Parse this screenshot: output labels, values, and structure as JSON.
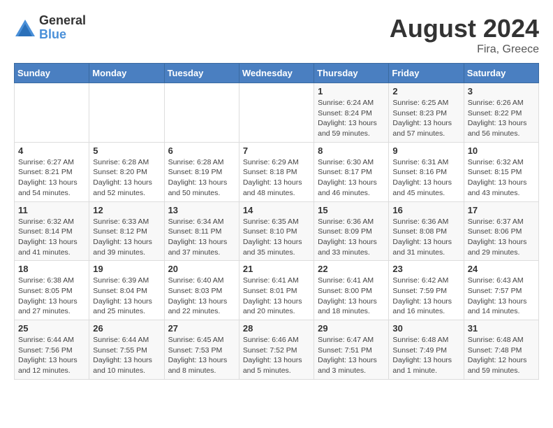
{
  "header": {
    "logo_general": "General",
    "logo_blue": "Blue",
    "month_year": "August 2024",
    "location": "Fira, Greece"
  },
  "weekdays": [
    "Sunday",
    "Monday",
    "Tuesday",
    "Wednesday",
    "Thursday",
    "Friday",
    "Saturday"
  ],
  "weeks": [
    [
      {
        "day": "",
        "detail": ""
      },
      {
        "day": "",
        "detail": ""
      },
      {
        "day": "",
        "detail": ""
      },
      {
        "day": "",
        "detail": ""
      },
      {
        "day": "1",
        "detail": "Sunrise: 6:24 AM\nSunset: 8:24 PM\nDaylight: 13 hours\nand 59 minutes."
      },
      {
        "day": "2",
        "detail": "Sunrise: 6:25 AM\nSunset: 8:23 PM\nDaylight: 13 hours\nand 57 minutes."
      },
      {
        "day": "3",
        "detail": "Sunrise: 6:26 AM\nSunset: 8:22 PM\nDaylight: 13 hours\nand 56 minutes."
      }
    ],
    [
      {
        "day": "4",
        "detail": "Sunrise: 6:27 AM\nSunset: 8:21 PM\nDaylight: 13 hours\nand 54 minutes."
      },
      {
        "day": "5",
        "detail": "Sunrise: 6:28 AM\nSunset: 8:20 PM\nDaylight: 13 hours\nand 52 minutes."
      },
      {
        "day": "6",
        "detail": "Sunrise: 6:28 AM\nSunset: 8:19 PM\nDaylight: 13 hours\nand 50 minutes."
      },
      {
        "day": "7",
        "detail": "Sunrise: 6:29 AM\nSunset: 8:18 PM\nDaylight: 13 hours\nand 48 minutes."
      },
      {
        "day": "8",
        "detail": "Sunrise: 6:30 AM\nSunset: 8:17 PM\nDaylight: 13 hours\nand 46 minutes."
      },
      {
        "day": "9",
        "detail": "Sunrise: 6:31 AM\nSunset: 8:16 PM\nDaylight: 13 hours\nand 45 minutes."
      },
      {
        "day": "10",
        "detail": "Sunrise: 6:32 AM\nSunset: 8:15 PM\nDaylight: 13 hours\nand 43 minutes."
      }
    ],
    [
      {
        "day": "11",
        "detail": "Sunrise: 6:32 AM\nSunset: 8:14 PM\nDaylight: 13 hours\nand 41 minutes."
      },
      {
        "day": "12",
        "detail": "Sunrise: 6:33 AM\nSunset: 8:12 PM\nDaylight: 13 hours\nand 39 minutes."
      },
      {
        "day": "13",
        "detail": "Sunrise: 6:34 AM\nSunset: 8:11 PM\nDaylight: 13 hours\nand 37 minutes."
      },
      {
        "day": "14",
        "detail": "Sunrise: 6:35 AM\nSunset: 8:10 PM\nDaylight: 13 hours\nand 35 minutes."
      },
      {
        "day": "15",
        "detail": "Sunrise: 6:36 AM\nSunset: 8:09 PM\nDaylight: 13 hours\nand 33 minutes."
      },
      {
        "day": "16",
        "detail": "Sunrise: 6:36 AM\nSunset: 8:08 PM\nDaylight: 13 hours\nand 31 minutes."
      },
      {
        "day": "17",
        "detail": "Sunrise: 6:37 AM\nSunset: 8:06 PM\nDaylight: 13 hours\nand 29 minutes."
      }
    ],
    [
      {
        "day": "18",
        "detail": "Sunrise: 6:38 AM\nSunset: 8:05 PM\nDaylight: 13 hours\nand 27 minutes."
      },
      {
        "day": "19",
        "detail": "Sunrise: 6:39 AM\nSunset: 8:04 PM\nDaylight: 13 hours\nand 25 minutes."
      },
      {
        "day": "20",
        "detail": "Sunrise: 6:40 AM\nSunset: 8:03 PM\nDaylight: 13 hours\nand 22 minutes."
      },
      {
        "day": "21",
        "detail": "Sunrise: 6:41 AM\nSunset: 8:01 PM\nDaylight: 13 hours\nand 20 minutes."
      },
      {
        "day": "22",
        "detail": "Sunrise: 6:41 AM\nSunset: 8:00 PM\nDaylight: 13 hours\nand 18 minutes."
      },
      {
        "day": "23",
        "detail": "Sunrise: 6:42 AM\nSunset: 7:59 PM\nDaylight: 13 hours\nand 16 minutes."
      },
      {
        "day": "24",
        "detail": "Sunrise: 6:43 AM\nSunset: 7:57 PM\nDaylight: 13 hours\nand 14 minutes."
      }
    ],
    [
      {
        "day": "25",
        "detail": "Sunrise: 6:44 AM\nSunset: 7:56 PM\nDaylight: 13 hours\nand 12 minutes."
      },
      {
        "day": "26",
        "detail": "Sunrise: 6:44 AM\nSunset: 7:55 PM\nDaylight: 13 hours\nand 10 minutes."
      },
      {
        "day": "27",
        "detail": "Sunrise: 6:45 AM\nSunset: 7:53 PM\nDaylight: 13 hours\nand 8 minutes."
      },
      {
        "day": "28",
        "detail": "Sunrise: 6:46 AM\nSunset: 7:52 PM\nDaylight: 13 hours\nand 5 minutes."
      },
      {
        "day": "29",
        "detail": "Sunrise: 6:47 AM\nSunset: 7:51 PM\nDaylight: 13 hours\nand 3 minutes."
      },
      {
        "day": "30",
        "detail": "Sunrise: 6:48 AM\nSunset: 7:49 PM\nDaylight: 13 hours\nand 1 minute."
      },
      {
        "day": "31",
        "detail": "Sunrise: 6:48 AM\nSunset: 7:48 PM\nDaylight: 12 hours\nand 59 minutes."
      }
    ]
  ]
}
